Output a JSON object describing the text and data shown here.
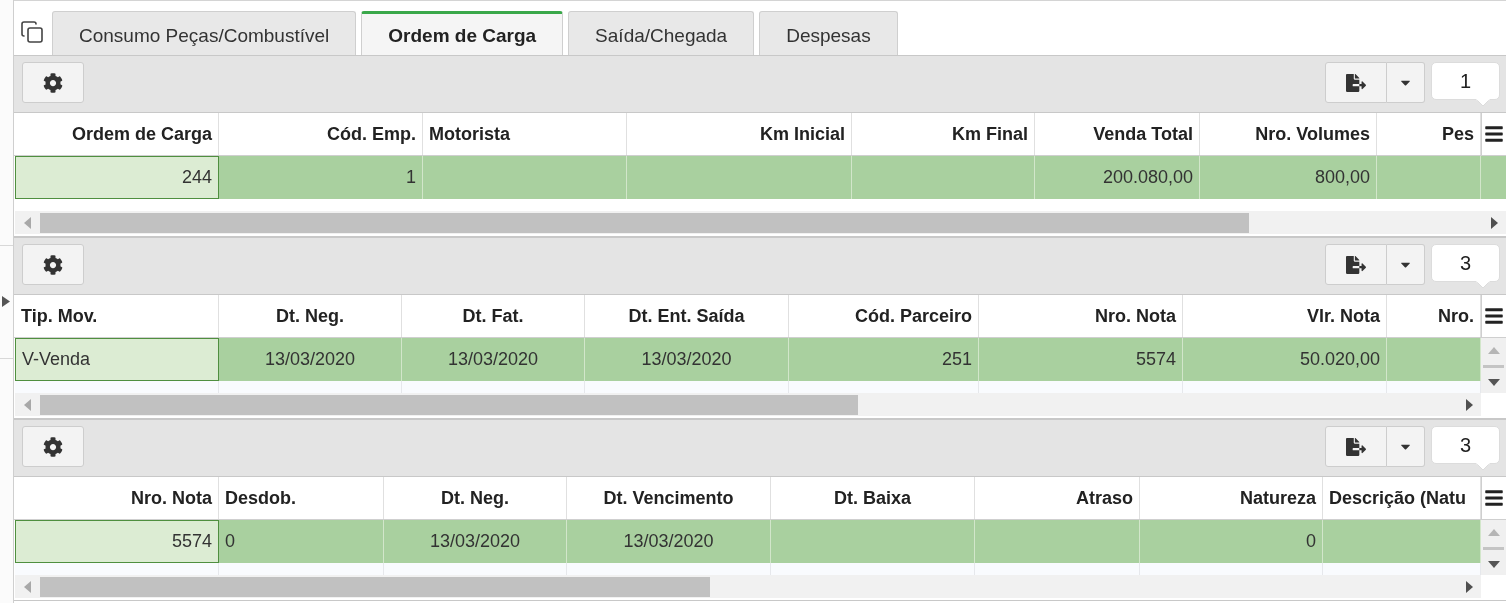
{
  "tabs": [
    {
      "label": "Consumo Peças/Combustível",
      "selected": false
    },
    {
      "label": "Ordem de Carga",
      "selected": true
    },
    {
      "label": "Saída/Chegada",
      "selected": false
    },
    {
      "label": "Despesas",
      "selected": false
    }
  ],
  "tables": [
    {
      "record_count": "1",
      "vertical_scrollbar": false,
      "columns": [
        "Ordem de Carga",
        "Cód. Emp.",
        "Motorista",
        "Km Inicial",
        "Km Final",
        "Venda Total",
        "Nro. Volumes",
        "Pes"
      ],
      "rows": [
        {
          "selected": true,
          "cells": [
            {
              "text": "244",
              "selected": true
            },
            {
              "text": "1",
              "selected": false
            },
            {
              "selected": false
            },
            {
              "selected": false
            },
            {
              "selected": false
            },
            {
              "text": "200.080,00",
              "selected": false
            },
            {
              "text": "800,00",
              "selected": false
            },
            {
              "selected": false
            }
          ]
        }
      ]
    },
    {
      "record_count": "3",
      "vertical_scrollbar": true,
      "columns": [
        "Tip. Mov.",
        "Dt. Neg.",
        "Dt. Fat.",
        "Dt. Ent. Saída",
        "Cód. Parceiro",
        "Nro. Nota",
        "Vlr. Nota",
        "Nro."
      ],
      "rows": [
        {
          "selected": true,
          "cells": [
            {
              "text": "V-Venda",
              "selected": true
            },
            {
              "text": "13/03/2020",
              "selected": false
            },
            {
              "text": "13/03/2020",
              "selected": false
            },
            {
              "text": "13/03/2020",
              "selected": false
            },
            {
              "text": "251",
              "selected": false
            },
            {
              "text": "5574",
              "selected": false
            },
            {
              "text": "50.020,00",
              "selected": false
            },
            {
              "selected": false
            }
          ]
        }
      ]
    },
    {
      "record_count": "3",
      "vertical_scrollbar": true,
      "columns": [
        "Nro. Nota",
        "Desdob.",
        "Dt. Neg.",
        "Dt. Vencimento",
        "Dt. Baixa",
        "Atraso",
        "Natureza",
        "Descrição (Natu"
      ],
      "rows": [
        {
          "selected": true,
          "cells": [
            {
              "text": "5574",
              "selected": true
            },
            {
              "text": "0",
              "selected": false
            },
            {
              "text": "13/03/2020",
              "selected": false
            },
            {
              "text": "13/03/2020",
              "selected": false
            },
            {
              "selected": false
            },
            {
              "selected": false
            },
            {
              "text": "0",
              "selected": false
            },
            {
              "selected": false
            }
          ]
        }
      ]
    }
  ]
}
